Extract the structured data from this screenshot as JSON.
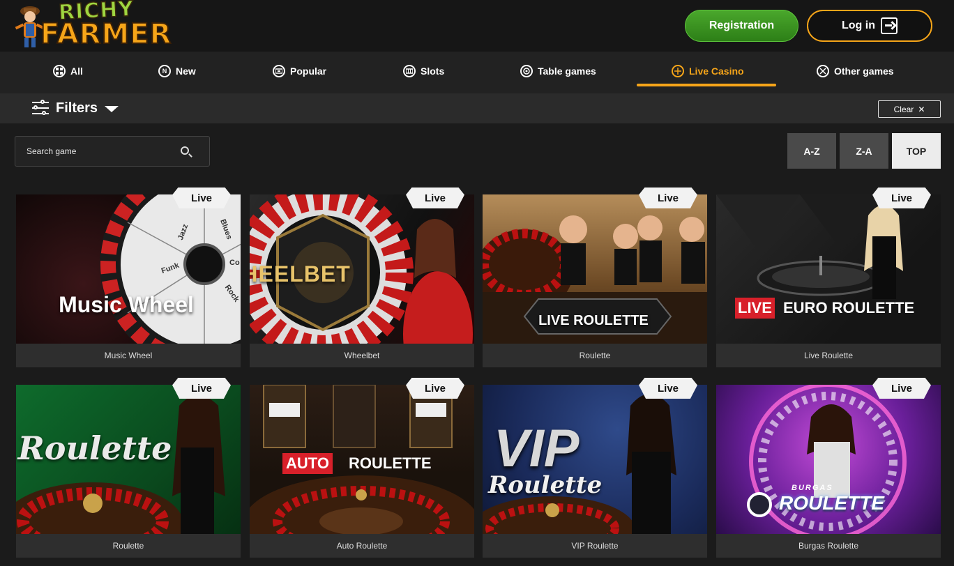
{
  "brand": {
    "line1": "RICHY",
    "line2": "FARMER"
  },
  "header": {
    "register_label": "Registration",
    "login_label": "Log in"
  },
  "nav": [
    {
      "label": "All",
      "icon": "grid-icon",
      "active": false
    },
    {
      "label": "New",
      "icon": "new-badge-icon",
      "active": false
    },
    {
      "label": "Popular",
      "icon": "popular-icon",
      "active": false
    },
    {
      "label": "Slots",
      "icon": "slots-icon",
      "active": false
    },
    {
      "label": "Table games",
      "icon": "table-games-icon",
      "active": false
    },
    {
      "label": "Live Casino",
      "icon": "live-casino-icon",
      "active": true
    },
    {
      "label": "Other games",
      "icon": "other-games-icon",
      "active": false
    }
  ],
  "filters": {
    "label": "Filters",
    "clear_label": "Clear"
  },
  "search": {
    "placeholder": "Search game"
  },
  "sort": [
    {
      "label": "A-Z",
      "active": false
    },
    {
      "label": "Z-A",
      "active": false
    },
    {
      "label": "TOP",
      "active": true
    }
  ],
  "live_tag": "Live",
  "games": [
    {
      "name": "Music Wheel",
      "thumb_text": "Music Wheel"
    },
    {
      "name": "Wheelbet",
      "thumb_text": "WHEELBET"
    },
    {
      "name": "Roulette",
      "thumb_text": "LIVE ROULETTE"
    },
    {
      "name": "Live Roulette",
      "thumb_text_a": "LIVE",
      "thumb_text_b": "EURO ROULETTE"
    },
    {
      "name": "Roulette",
      "thumb_text": "Roulette"
    },
    {
      "name": "Auto Roulette",
      "thumb_text_a": "AUTO",
      "thumb_text_b": "ROULETTE"
    },
    {
      "name": "VIP Roulette",
      "thumb_text_a": "VIP",
      "thumb_text_b": "Roulette"
    },
    {
      "name": "Burgas Roulette",
      "thumb_text_a": "BURGAS",
      "thumb_text_b": "ROULETTE"
    }
  ],
  "music_wheel_segments": [
    "Jazz",
    "Blues",
    "Funk",
    "Rock",
    "Co"
  ],
  "colors": {
    "accent": "#f6a519",
    "register_green": "#3a9a23",
    "live_red": "#d8202a"
  }
}
